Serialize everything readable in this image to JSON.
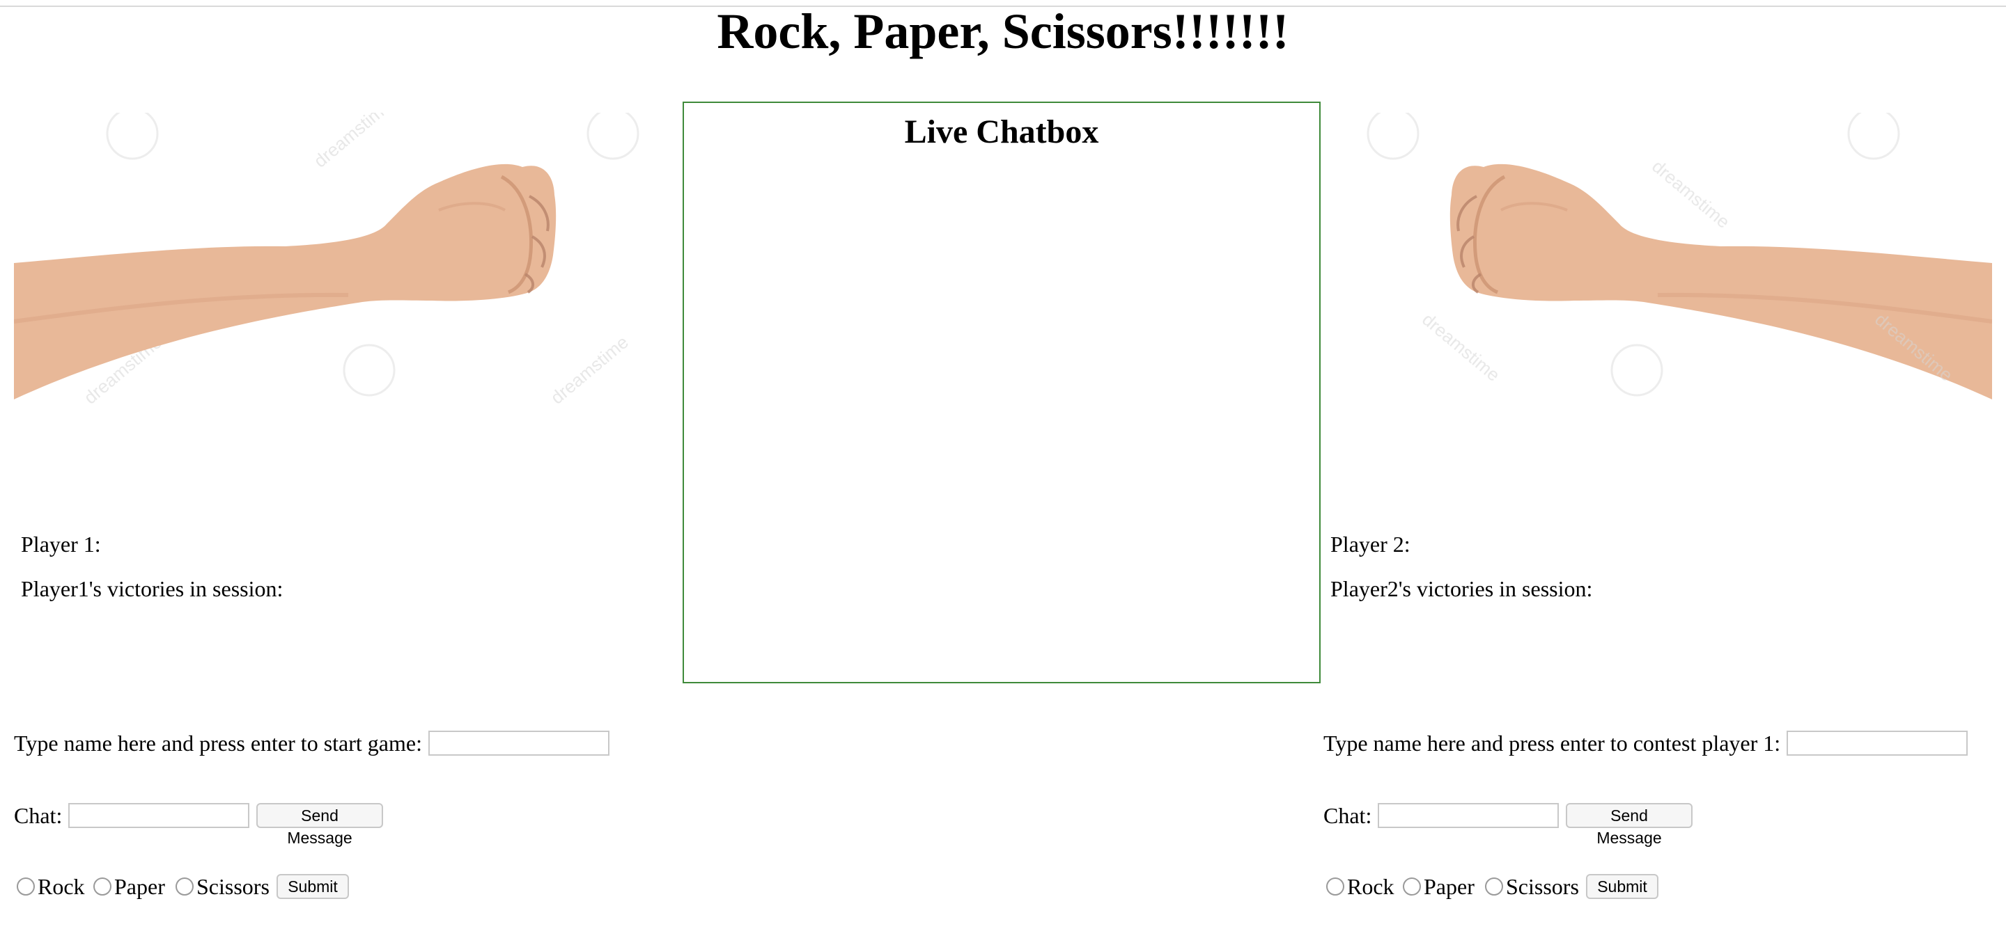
{
  "page_title": "Rock, Paper, Scissors!!!!!!!",
  "chatbox": {
    "title": "Live Chatbox"
  },
  "player1": {
    "name_label": "Player 1:",
    "victories_label": "Player1's victories in session:",
    "name_prompt": "Type name here and press enter to start game:",
    "chat_label": "Chat:",
    "send_label": "Send Message",
    "options": [
      "Rock",
      "Paper",
      "Scissors"
    ],
    "submit_label": "Submit"
  },
  "player2": {
    "name_label": "Player 2:",
    "victories_label": "Player2's victories in session:",
    "name_prompt": "Type name here and press enter to contest player 1:",
    "chat_label": "Chat:",
    "send_label": "Send Message",
    "options": [
      "Rock",
      "Paper",
      "Scissors"
    ],
    "submit_label": "Submit"
  },
  "watermark": "dreamstime",
  "colors": {
    "chatbox_border": "#3f8a3a",
    "skin": "#e8b898"
  }
}
